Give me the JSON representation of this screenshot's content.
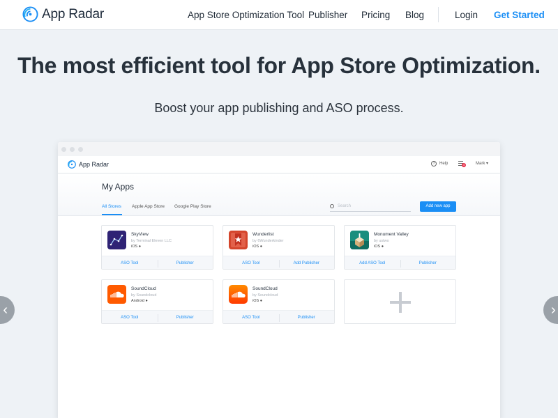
{
  "brand": {
    "name": "App Radar",
    "accent": "#1a8ef5"
  },
  "nav": {
    "links": [
      "App Store Optimization Tool",
      "Publisher",
      "Pricing",
      "Blog"
    ],
    "login": "Login",
    "cta": "Get Started"
  },
  "hero": {
    "title": "The most efficient tool for App Store Optimization.",
    "subtitle": "Boost your app publishing and ASO process."
  },
  "carousel": {
    "prev_icon": "chevron-left-icon",
    "next_icon": "chevron-right-icon",
    "prev_glyph": "‹",
    "next_glyph": "›"
  },
  "mockup": {
    "app_name": "App Radar",
    "help": "Help",
    "help_glyph": "?",
    "notification_count": "4",
    "user": "Mark ▾",
    "page_title": "My Apps",
    "tabs": [
      "All Stores",
      "Apple App Store",
      "Google Play Store"
    ],
    "search_placeholder": "Search",
    "add_button": "Add new app",
    "apps": [
      {
        "name": "SkyView",
        "by": "by Terminal Eleven LLC",
        "platform": "iOS ",
        "action1": "ASO Tool",
        "action2": "Publisher",
        "icon": "skyview-icon"
      },
      {
        "name": "Wunderlist",
        "by": "by 6Wunderkinder",
        "platform": "iOS ",
        "action1": "ASO Tool",
        "action2": "Add Publisher",
        "icon": "wunderlist-icon"
      },
      {
        "name": "Monument Valley",
        "by": "by ustwo",
        "platform": "iOS ",
        "action1": "Add ASO Tool",
        "action2": "Publisher",
        "icon": "monument-valley-icon"
      },
      {
        "name": "SoundCloud",
        "by": "by Soundcloud",
        "platform": "Android ",
        "action1": "ASO Tool",
        "action2": "Publisher",
        "icon": "soundcloud-icon"
      },
      {
        "name": "SoundCloud",
        "by": "by Soundcloud",
        "platform": "iOS ",
        "action1": "ASO Tool",
        "action2": "Publisher",
        "icon": "soundcloud-icon"
      }
    ]
  }
}
